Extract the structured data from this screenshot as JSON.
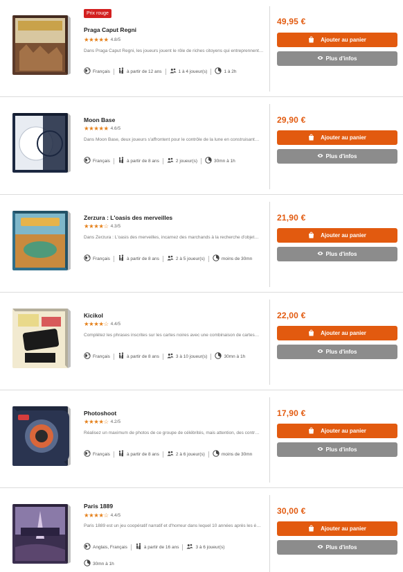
{
  "ui": {
    "add_to_cart": "Ajouter au panier",
    "more_info": "Plus d'infos"
  },
  "products": [
    {
      "badge": "Prix rouge",
      "title": "Praga Caput Regni",
      "rating": "4.8/5",
      "stars": 5,
      "description": "Dans Praga Caput Regni, les joueurs jouent le rôle de riches citoyens qui entreprennent…",
      "language": "Français",
      "age": "à partir de 12 ans",
      "players": "1 à 4 joueur(s)",
      "duration": "1 à 2h",
      "price": "49,95 €",
      "box_icon": "praga-caput-regni-box",
      "box_colors": {
        "bg": "#5b3a2a",
        "accent": "#c9a24a",
        "sky": "#d8c7a0"
      }
    },
    {
      "badge": "",
      "title": "Moon Base",
      "rating": "4.6/5",
      "stars": 5,
      "description": "Dans Moon Base, deux joueurs s'affrontent pour le contrôle de la lune en construisant…",
      "language": "Français",
      "age": "à partir de 8 ans",
      "players": "2 joueur(s)",
      "duration": "30mn à 1h",
      "price": "29,90 €",
      "box_icon": "moon-base-box",
      "box_colors": {
        "bg": "#1b2740",
        "accent": "#e8ecf2",
        "sky": "#2c3b5e"
      }
    },
    {
      "badge": "",
      "title": "Zerzura : L'oasis des merveilles",
      "rating": "4.3/5",
      "stars": 4,
      "description": "Dans Zerzura : L'oasis des merveilles, incarnez des marchands à la recherche d'objet…",
      "language": "Français",
      "age": "à partir de 8 ans",
      "players": "2 à 5 joueur(s)",
      "duration": "moins de 30mn",
      "price": "21,90 €",
      "box_icon": "zerzura-box",
      "box_colors": {
        "bg": "#2f6e8a",
        "accent": "#e6b34a",
        "sky": "#7fb7c9"
      }
    },
    {
      "badge": "",
      "title": "Kicikol",
      "rating": "4.4/5",
      "stars": 4,
      "description": "Complétez les phrases inscrites sur les cartes noires avec une combinaison de cartes…",
      "language": "Français",
      "age": "à partir de 8 ans",
      "players": "3 à 10 joueur(s)",
      "duration": "30mn à 1h",
      "price": "22,00 €",
      "box_icon": "kicikol-box",
      "box_colors": {
        "bg": "#f2ead0",
        "accent": "#1a1a1a",
        "sky": "#e9d98a"
      }
    },
    {
      "badge": "",
      "title": "Photoshoot",
      "rating": "4.2/5",
      "stars": 4,
      "description": "Réalisez un maximum de photos de ce groupe de célébrités, mais attention, des contr…",
      "language": "Français",
      "age": "à partir de 8 ans",
      "players": "2 à 6 joueur(s)",
      "duration": "moins de 30mn",
      "price": "17,90 €",
      "box_icon": "photoshoot-box",
      "box_colors": {
        "bg": "#2a3450",
        "accent": "#d9663a",
        "sky": "#5a6a8c"
      }
    },
    {
      "badge": "",
      "title": "Paris 1889",
      "rating": "4.4/5",
      "stars": 4,
      "description": "Paris 1889 est un jeu coopératif narratif et d'horreur dans lequel 10 années après les é…",
      "language": "Anglais, Français",
      "age": "à partir de 16 ans",
      "players": "3 à 6 joueur(s)",
      "duration": "30mn à 1h",
      "price": "30,00 €",
      "box_icon": "paris-1889-box",
      "box_colors": {
        "bg": "#3b2f4f",
        "accent": "#d9c9e6",
        "sky": "#8a7aa8"
      }
    }
  ]
}
